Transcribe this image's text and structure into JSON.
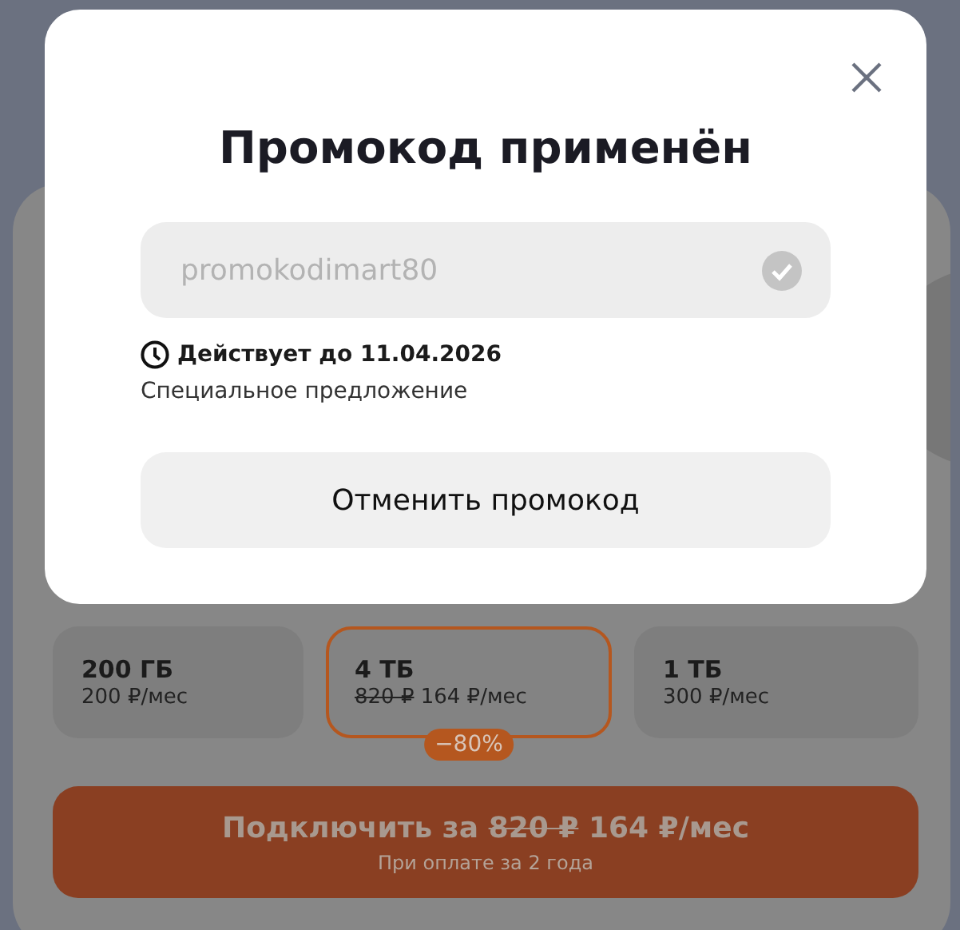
{
  "dialog": {
    "title": "Промокод применён",
    "promo_field": {
      "value": "promokodimart80",
      "applied": true
    },
    "validity": "Действует до 11.04.2026",
    "note": "Специальное предложение",
    "cancel_button": "Отменить промокод"
  },
  "plans": [
    {
      "name": "200 ГБ",
      "price": "200 ₽/мес",
      "selected": false
    },
    {
      "name": "4 ТБ",
      "old_price": "820 ₽",
      "price": "164 ₽/мес",
      "badge": "−80%",
      "selected": true
    },
    {
      "name": "1 ТБ",
      "price": "300 ₽/мес",
      "selected": false
    }
  ],
  "cta": {
    "label": "Подключить за",
    "old_price": "820 ₽",
    "price": "164 ₽/мес",
    "note": "При оплате за 2 года"
  }
}
